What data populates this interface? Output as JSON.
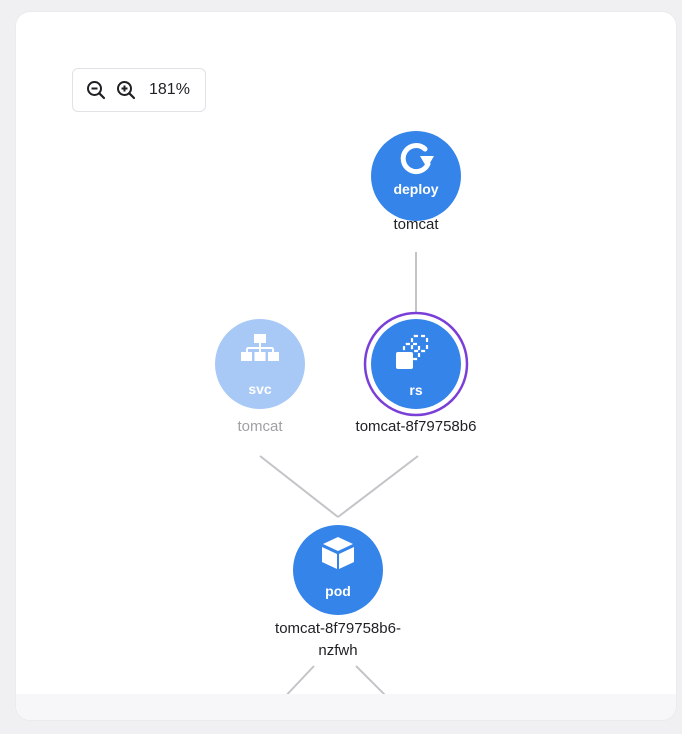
{
  "zoom": {
    "level": "181%",
    "zoom_out_icon": "zoom-out-icon",
    "zoom_in_icon": "zoom-in-icon"
  },
  "colors": {
    "node": "#3584ea",
    "node_faded": "#a8c8f6",
    "selected_ring": "#7a3fd6",
    "edge": "#c4c4c8"
  },
  "nodes": {
    "deploy": {
      "type": "deploy",
      "name": "tomcat",
      "icon": "rollout-icon"
    },
    "rs": {
      "type": "rs",
      "name": "tomcat-8f79758b6",
      "icon": "replicaset-icon",
      "selected": true
    },
    "svc": {
      "type": "svc",
      "name": "tomcat",
      "icon": "sitemap-icon",
      "faded": true
    },
    "pod": {
      "type": "pod",
      "name_line1": "tomcat-8f79758b6-",
      "name_line2": "nzfwh",
      "icon": "cube-icon"
    }
  }
}
